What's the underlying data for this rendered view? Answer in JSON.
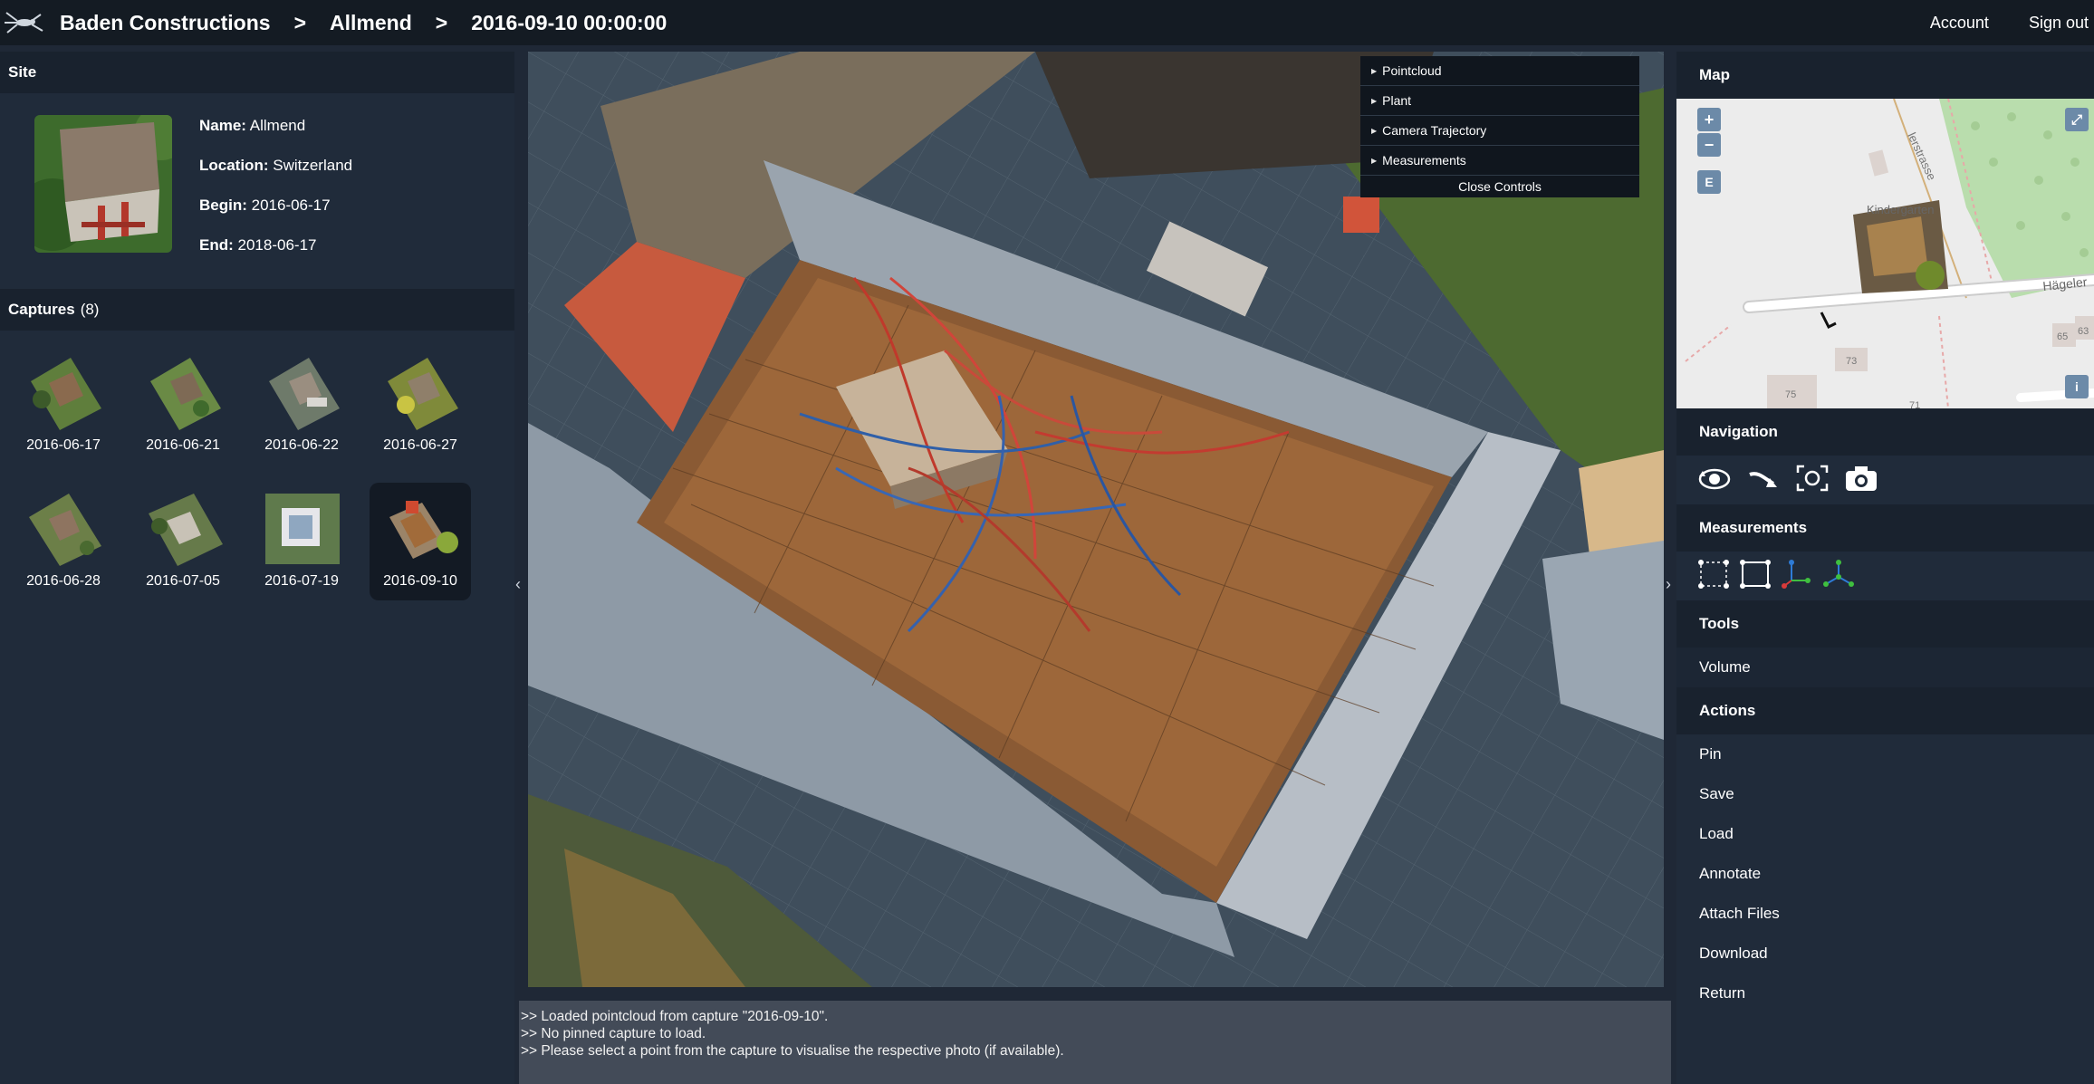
{
  "header": {
    "breadcrumb": [
      "Baden Constructions",
      "Allmend",
      "2016-09-10 00:00:00"
    ],
    "separator": ">",
    "account": "Account",
    "sign_out": "Sign out"
  },
  "site": {
    "section_title": "Site",
    "name_label": "Name:",
    "name": "Allmend",
    "location_label": "Location:",
    "location": "Switzerland",
    "begin_label": "Begin:",
    "begin": "2016-06-17",
    "end_label": "End:",
    "end": "2018-06-17"
  },
  "captures": {
    "section_title": "Captures",
    "count": "(8)",
    "items": [
      {
        "date": "2016-06-17"
      },
      {
        "date": "2016-06-21"
      },
      {
        "date": "2016-06-22"
      },
      {
        "date": "2016-06-27"
      },
      {
        "date": "2016-06-28"
      },
      {
        "date": "2016-07-05"
      },
      {
        "date": "2016-07-19"
      },
      {
        "date": "2016-09-10",
        "selected": true
      }
    ]
  },
  "viewer_controls": {
    "items": [
      "Pointcloud",
      "Plant",
      "Camera Trajectory",
      "Measurements"
    ],
    "close": "Close Controls"
  },
  "console": {
    "lines": [
      ">> Loaded pointcloud from capture \"2016-09-10\".",
      ">> No pinned capture to load.",
      ">> Please select a point from the capture to visualise the respective photo (if available)."
    ]
  },
  "right_panel": {
    "map_title": "Map",
    "map_labels": {
      "street_top": "lerstrasse",
      "kindergarten": "Kindergarten",
      "street_right": "Hägeler",
      "n73": "73",
      "n75": "75",
      "n71": "71",
      "n65": "65",
      "n63": "63"
    },
    "map_buttons": {
      "zoom_in": "+",
      "zoom_out": "−",
      "edit": "E",
      "info": "i"
    },
    "navigation_title": "Navigation",
    "navigation_icons": [
      "orbit-icon",
      "fly-icon",
      "focus-icon",
      "camera-icon"
    ],
    "measurements_title": "Measurements",
    "measurement_icons": [
      "distance-icon",
      "area-icon",
      "height-icon",
      "angle-icon"
    ],
    "tools_title": "Tools",
    "tools": [
      "Volume"
    ],
    "actions_title": "Actions",
    "actions": [
      "Pin",
      "Save",
      "Load",
      "Annotate",
      "Attach Files",
      "Download",
      "Return"
    ]
  },
  "colors": {
    "topbar": "#141b23",
    "panel": "#202b3a",
    "section_header": "#19222e",
    "console": "#434b58",
    "map_button": "#6c8aa8"
  }
}
